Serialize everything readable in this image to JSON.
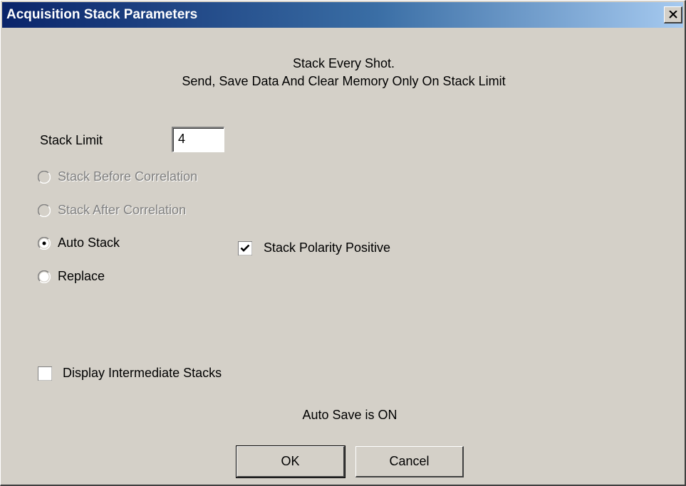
{
  "window": {
    "title": "Acquisition Stack Parameters",
    "close_icon": "close-icon"
  },
  "description": {
    "line1": "Stack Every Shot.",
    "line2": "Send, Save Data And Clear Memory Only On Stack Limit"
  },
  "stack_limit": {
    "label": "Stack Limit",
    "value": "4"
  },
  "options": {
    "stack_before_correlation": {
      "label": "Stack Before Correlation",
      "enabled": false,
      "selected": false
    },
    "stack_after_correlation": {
      "label": "Stack After Correlation",
      "enabled": false,
      "selected": false
    },
    "auto_stack": {
      "label": "Auto Stack",
      "enabled": true,
      "selected": true
    },
    "replace": {
      "label": "Replace",
      "enabled": true,
      "selected": false
    }
  },
  "stack_polarity_positive": {
    "label": "Stack Polarity Positive",
    "checked": true
  },
  "display_intermediate_stacks": {
    "label": "Display Intermediate Stacks",
    "checked": false
  },
  "auto_save_status": "Auto Save is ON",
  "buttons": {
    "ok": "OK",
    "cancel": "Cancel"
  },
  "colors": {
    "face": "#d4d0c8",
    "title_start": "#0a246a",
    "title_end": "#a6caf0",
    "disabled_text": "#808080"
  }
}
